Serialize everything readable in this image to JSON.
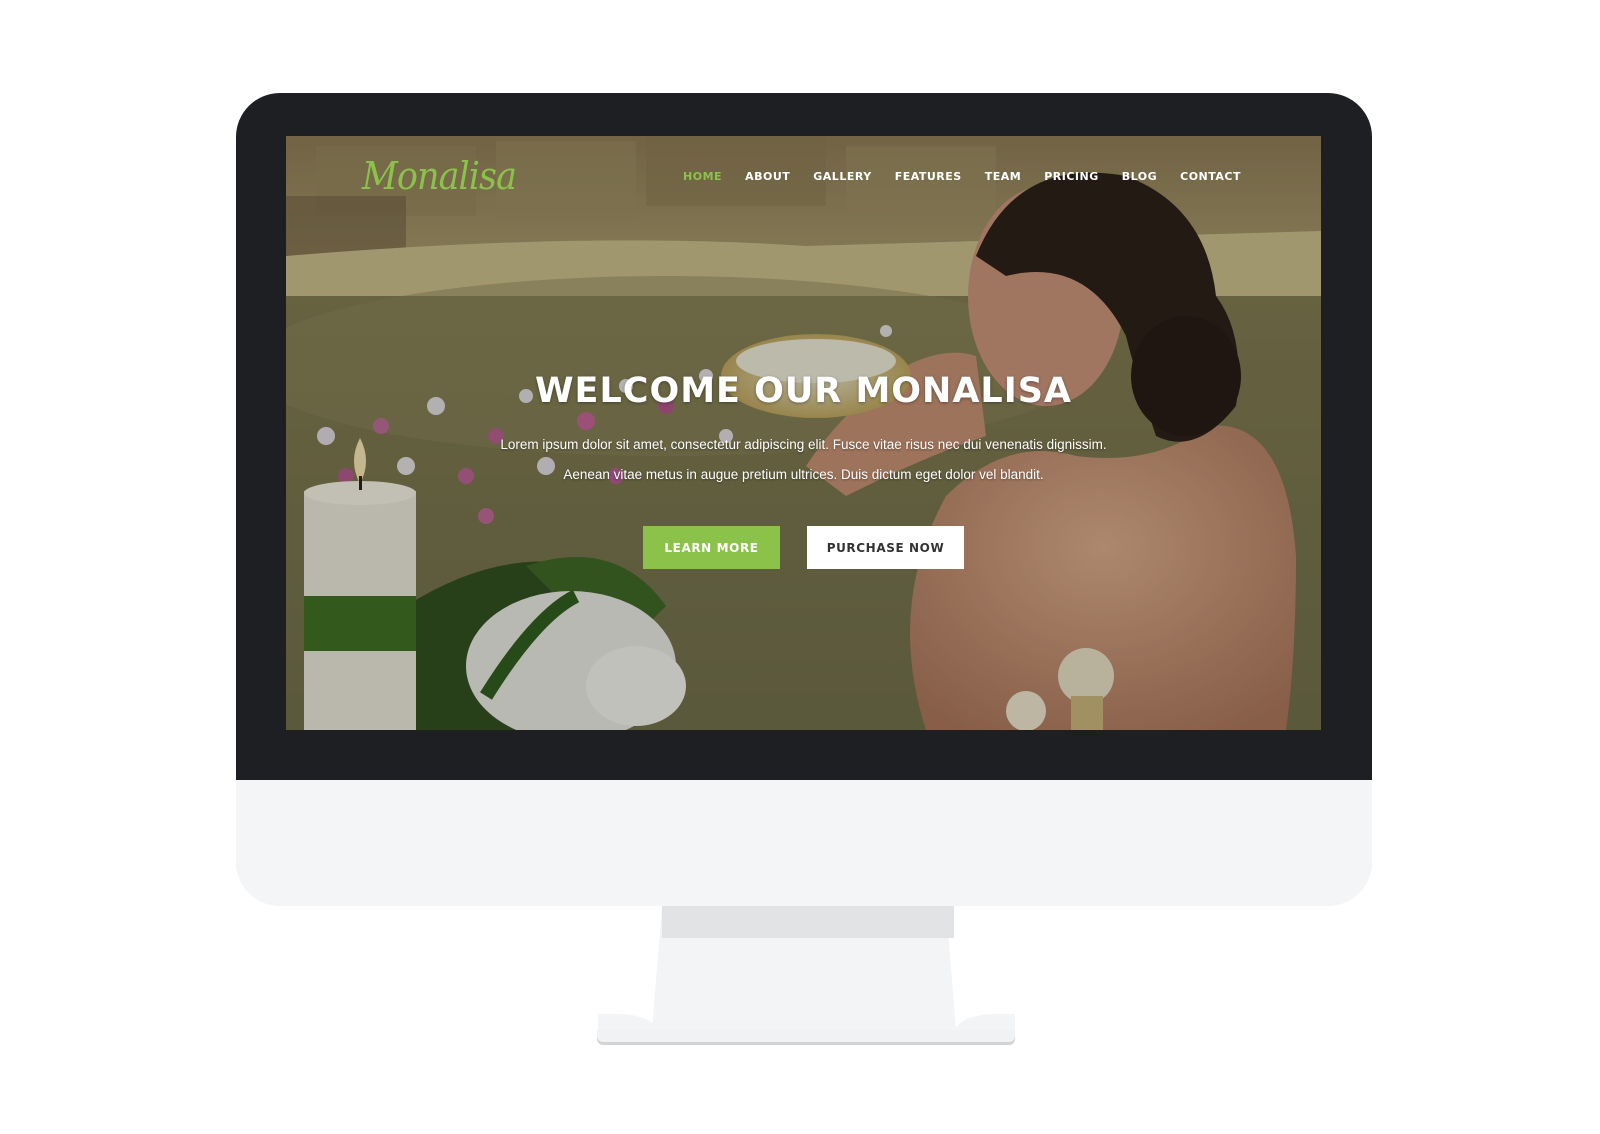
{
  "colors": {
    "accent": "#8bc34a",
    "bezel": "#1e1f23",
    "chin": "#f4f5f7"
  },
  "site": {
    "logo": "Monalisa"
  },
  "nav": {
    "items": [
      {
        "label": "HOME",
        "active": true
      },
      {
        "label": "ABOUT"
      },
      {
        "label": "GALLERY"
      },
      {
        "label": "FEATURES"
      },
      {
        "label": "TEAM"
      },
      {
        "label": "PRICING"
      },
      {
        "label": "BLOG"
      },
      {
        "label": "CONTACT"
      }
    ]
  },
  "hero": {
    "title": "WELCOME OUR MONALISA",
    "line1": "Lorem ipsum dolor sit amet, consectetur adipiscing elit. Fusce vitae risus nec dui venenatis dignissim.",
    "line2": "Aenean vitae metus in augue pretium ultrices. Duis dictum eget dolor vel blandit.",
    "learn_more": "LEARN MORE",
    "purchase_now": "PURCHASE NOW"
  }
}
